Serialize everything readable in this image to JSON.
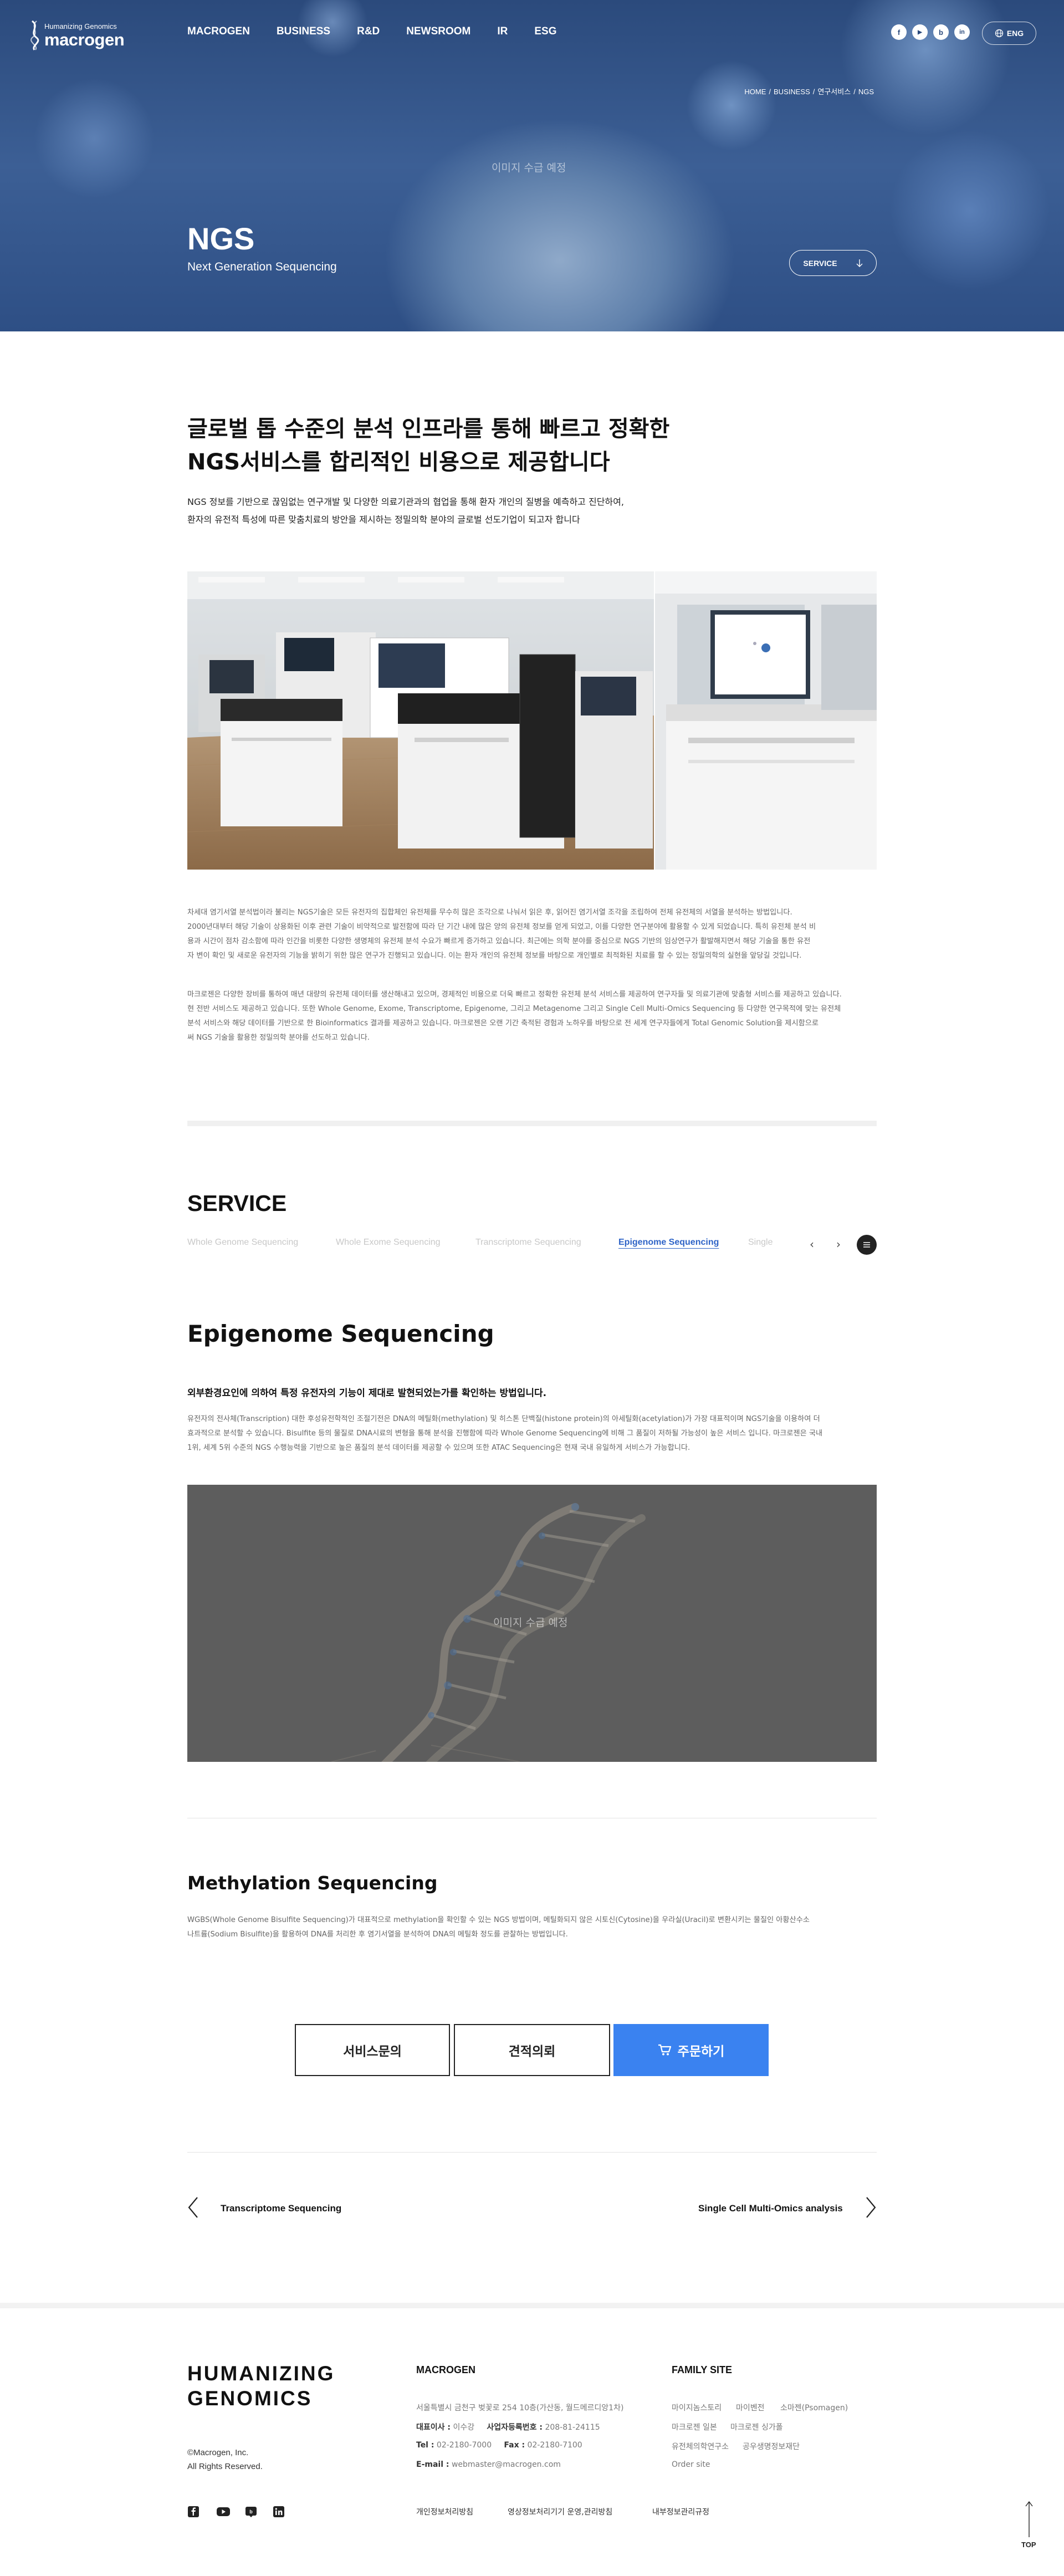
{
  "header": {
    "logo_sub": "Humanizing Genomics",
    "logo_name": "macrogen",
    "nav": [
      "MACROGEN",
      "BUSINESS",
      "R&D",
      "NEWSROOM",
      "IR",
      "ESG"
    ],
    "social": [
      "f",
      "▶",
      "b",
      "in"
    ],
    "lang": "ENG"
  },
  "hero": {
    "breadcrumb": [
      "HOME",
      "BUSINESS",
      "연구서비스",
      "NGS"
    ],
    "placeholder": "이미지 수급 예정",
    "title": "NGS",
    "subtitle": "Next Generation Sequencing",
    "service_button": "SERVICE"
  },
  "intro": {
    "headline_1": "글로벌 톱 수준의 분석 인프라를 통해 빠르고 정확한",
    "headline_2": "NGS서비스를 합리적인 비용으로 제공합니다",
    "desc_1": "NGS 정보를 기반으로 끊임없는 연구개발 및 다양한 의료기관과의 협업을 통해 환자 개인의 질병을 예측하고 진단하여,",
    "desc_2": "환자의 유전적 특성에 따른 맞춤치료의 방안을 제시하는 정밀의학 분야의 글로벌 선도기업이 되고자 합니다",
    "para_1": [
      "차세대 염기서열 분석법이라 불리는 NGS기술은 모든 유전자의 집합체인 유전체를 무수히 많은 조각으로 나눠서 읽은 후, 읽어진 염기서열 조각을 조립하여 전체 유전체의 서열을 분석하는 방법입니다.",
      "2000년대부터 해당 기술이 상용화된 이후 관련 기술이 비약적으로 발전함에 따라 단 기간 내에 많은 양의 유전체 정보를 얻게 되었고, 이를 다양한 연구분야에 활용할 수 있게 되었습니다. 특히 유전체 분석 비",
      "용과 시간이 점차 감소함에 따라 인간을 비롯한 다양한 생명체의 유전체 분석 수요가 빠르게 증가하고 있습니다. 최근에는 의학 분야를 중심으로 NGS 기반의 임상연구가 활발해지면서 해당 기술을 통한 유전",
      "자 변이 확인 및 새로운 유전자의 기능을 밝히기 위한 많은 연구가 진행되고 있습니다. 이는 환자 개인의 유전체 정보를 바탕으로 개인별로 최적화된 치료를 할 수 있는 정밀의학의 실현을 앞당길 것입니다."
    ],
    "para_2": [
      "마크로젠은 다양한 장비를 통하여 매년 대량의 유전체 데이터를 생산해내고 있으며, 경제적인 비용으로 더욱 빠르고 정확한 유전체 분석 서비스를 제공하여 연구자들 및 의료기관에 맞춤형 서비스를 제공하고 있습니다.",
      "현 전반 서비스도 제공하고 있습니다. 또한 Whole Genome, Exome, Transcriptome, Epigenome, 그리고 Metagenome 그리고 Single Cell Multi-Omics Sequencing 등 다양한 연구목적에 맞는 유전체",
      "분석 서비스와 해당 데이터를 기반으로 한 Bioinformatics 결과를 제공하고 있습니다. 마크로젠은 오랜 기간 축적된 경험과 노하우를 바탕으로 전 세계 연구자들에게 Total Genomic Solution을 제시함으로",
      "써 NGS 기술을 활용한 정밀의학 분야를 선도하고 있습니다."
    ]
  },
  "service": {
    "title": "SERVICE",
    "tabs": [
      "Whole Genome Sequencing",
      "Whole Exome Sequencing",
      "Transcriptome Sequencing",
      "Epigenome Sequencing",
      "Single"
    ],
    "active_tab": 3,
    "prev": "‹",
    "next": "›"
  },
  "epigenome": {
    "title": "Epigenome Sequencing",
    "lead": "외부환경요인에 의하여 특정 유전자의 기능이 제대로 발현되었는가를 확인하는 방법입니다.",
    "desc": [
      "유전자의 전사체(Transcription) 대한 후성유전학적인 조절기전은 DNA의 메틸화(methylation) 및 히스톤 단백질(histone protein)의 아세틸화(acetylation)가 가장 대표적이며 NGS기술을 이용하여 더",
      "효과적으로 분석할 수 있습니다. Bisulfite 등의 물질로 DNA시료의 변형을 통해 분석을 진행함에 따라 Whole Genome Sequencing에 비해 그 품질이 저하될 가능성이 높은 서비스 입니다. 마크로젠은 국내",
      "1위, 세계 5위 수준의 NGS 수행능력을 기반으로 높은 품질의 분석 데이터를 제공할 수 있으며 또한 ATAC Sequencing은 현재 국내 유일하게 서비스가 가능합니다."
    ],
    "image_placeholder": "이미지 수급 예정"
  },
  "methylation": {
    "title": "Methylation Sequencing",
    "desc": [
      "WGBS(Whole Genome Bisulfite Sequencing)가 대표적으로 methylation을 확인할 수 있는 NGS 방법이며, 메틸화되지 않은 시토신(Cytosine)을 우라실(Uracil)로 변환시키는 물질인 아황산수소",
      "나트륨(Sodium Bisulfite)을 활용하여 DNA를 처리한 후 염기서열을 분석하여 DNA의 메틸화 정도를 관찰하는 방법입니다."
    ]
  },
  "actions": {
    "inquiry": "서비스문의",
    "quote": "견적의뢰",
    "order": "주문하기"
  },
  "pager": {
    "prev": "Transcriptome Sequencing",
    "next": "Single Cell Multi-Omics analysis"
  },
  "footer": {
    "brand_1": "HUMANIZING",
    "brand_2": "GENOMICS",
    "copyright_1": "©Macrogen, Inc.",
    "copyright_2": "All Rights Reserved.",
    "company_heading": "MACROGEN",
    "address": "서울특별시 금천구 벚꽃로 254 10층(가산동, 월드메르디앙1차)",
    "ceo_label": "대표이사 :",
    "ceo": "이수강",
    "bizno_label": "사업자등록번호 :",
    "bizno": "208-81-24115",
    "tel_label": "Tel :",
    "tel": "02-2180-7000",
    "fax_label": "Fax :",
    "fax": "02-2180-7100",
    "email_label": "E-mail :",
    "email": "webmaster@macrogen.com",
    "family_heading": "FAMILY SITE",
    "family": [
      "마이지놈스토리",
      "마이벤전",
      "소마젠(Psomagen)",
      "마크로젠 일본",
      "마크로젠 싱가폴",
      "유전체의학연구소",
      "공우생명정보재단",
      "Order site"
    ],
    "links": [
      "개인정보처리방침",
      "영상정보처리기기 운영,관리방침",
      "내부정보관리규정"
    ],
    "top": "TOP"
  }
}
